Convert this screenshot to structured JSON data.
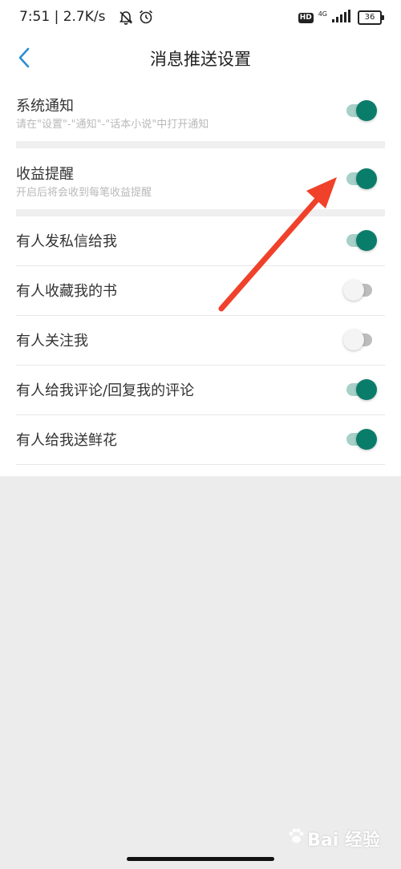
{
  "status_bar": {
    "time": "7:51 | 2.7K/s",
    "hd": "HD",
    "network": "4G",
    "battery": "36"
  },
  "header": {
    "title": "消息推送设置"
  },
  "settings": [
    {
      "label": "系统通知",
      "sub": "请在\"设置\"-\"通知\"-\"话本小说\"中打开通知",
      "enabled": true
    },
    {
      "label": "收益提醒",
      "sub": "开启后将会收到每笔收益提醒",
      "enabled": true
    },
    {
      "label": "有人发私信给我",
      "enabled": true
    },
    {
      "label": "有人收藏我的书",
      "enabled": false
    },
    {
      "label": "有人关注我",
      "enabled": false
    },
    {
      "label": "有人给我评论/回复我的评论",
      "enabled": true
    },
    {
      "label": "有人给我送鲜花",
      "enabled": true
    }
  ],
  "colors": {
    "toggle_on_knob": "#0a7d6a",
    "toggle_on_track": "#a6d0c8",
    "toggle_off_track": "#bdbdbd",
    "accent_back": "#2b8fd6",
    "annotation_arrow": "#f0412a"
  },
  "watermark": {
    "text": "Bai 经验"
  }
}
